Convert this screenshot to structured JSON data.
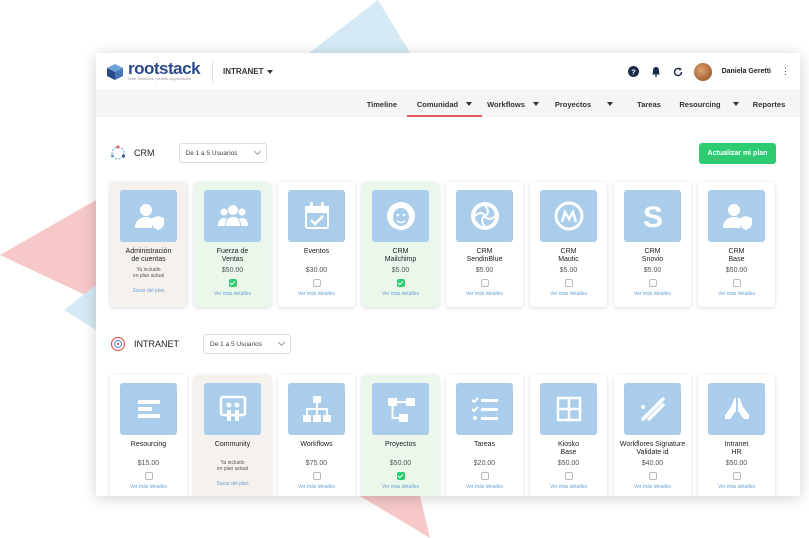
{
  "brand": {
    "name": "rootstack",
    "tagline": "Web Solutions | Mobile Applications"
  },
  "topbar": {
    "section_label": "INTRANET",
    "username": "Daniela Geretti",
    "icons": [
      "help-icon",
      "bell-icon",
      "refresh-icon"
    ]
  },
  "nav": {
    "items": [
      "Timeline",
      "Comunidad",
      "Workflows",
      "Proyectos",
      "Tareas",
      "Resourcing",
      "Reportes"
    ],
    "active": "Comunidad"
  },
  "crm": {
    "title": "CRM",
    "select": "De 1 a 5 Usuarios",
    "upgrade_label": "Actualizar mi plan",
    "cards": [
      {
        "name": "Administración\nde cuentas",
        "note": "Ya incluido\nen plan actual",
        "link": "Sacar del plan",
        "state": "included",
        "icon": "user-shield-icon"
      },
      {
        "name": "Fuerza de\nVentas",
        "price": "$50.00",
        "link": "Ver más detalles",
        "state": "selected",
        "icon": "team-icon"
      },
      {
        "name": "Eventos",
        "price": "$30.00",
        "link": "Ver más detalles",
        "state": "default",
        "icon": "calendar-icon"
      },
      {
        "name": "CRM\nMailchimp",
        "price": "$5.00",
        "link": "Ver más detalles",
        "state": "selected",
        "icon": "mailchimp-icon"
      },
      {
        "name": "CRM\nSendinBlue",
        "price": "$5.00",
        "link": "Ver más detalles",
        "state": "default",
        "icon": "sendinblue-icon"
      },
      {
        "name": "CRM\nMautic",
        "price": "$5.00",
        "link": "Ver más detalles",
        "state": "default",
        "icon": "mautic-icon"
      },
      {
        "name": "CRM\nSnovio",
        "price": "$5.00",
        "link": "Ver más detalles",
        "state": "default",
        "icon": "snovio-icon"
      },
      {
        "name": "CRM\nBase",
        "price": "$50.00",
        "link": "Ver más detalles",
        "state": "default",
        "icon": "user-shield-icon"
      }
    ]
  },
  "intranet": {
    "title": "INTRANET",
    "select": "De 1 a 5 Usuarios",
    "cards": [
      {
        "name": "Resourcing",
        "price": "$15.00",
        "link": "Ver más detalles",
        "state": "default",
        "icon": "bars-icon"
      },
      {
        "name": "Community",
        "note": "Ya incluido\nen plan actual",
        "link": "Sacar del plan",
        "state": "included",
        "icon": "community-icon"
      },
      {
        "name": "Workflows",
        "price": "$75.00",
        "link": "Ver más detalles",
        "state": "default",
        "icon": "sitemap-icon"
      },
      {
        "name": "Proyectos",
        "price": "$50.00",
        "link": "Ver más detalles",
        "state": "selected",
        "icon": "flow-icon"
      },
      {
        "name": "Tareas",
        "price": "$20.00",
        "link": "Ver más detalles",
        "state": "default",
        "icon": "checklist-icon"
      },
      {
        "name": "Kiosko\nBase",
        "price": "$50.00",
        "link": "Ver más detalles",
        "state": "default",
        "icon": "grid-icon"
      },
      {
        "name": "Workflores Signature\nValidate id",
        "price": "$40.00",
        "link": "Ver más detalles",
        "state": "default",
        "icon": "signature-icon"
      },
      {
        "name": "Intranet\nHR",
        "price": "$50.00",
        "link": "Ver más detalles",
        "state": "default",
        "icon": "hands-icon"
      }
    ]
  },
  "colors": {
    "accent_green": "#2ecc71",
    "tile_blue": "#a9cdea",
    "nav_underline": "#e85c5c",
    "brand_blue": "#2a4a8a"
  }
}
